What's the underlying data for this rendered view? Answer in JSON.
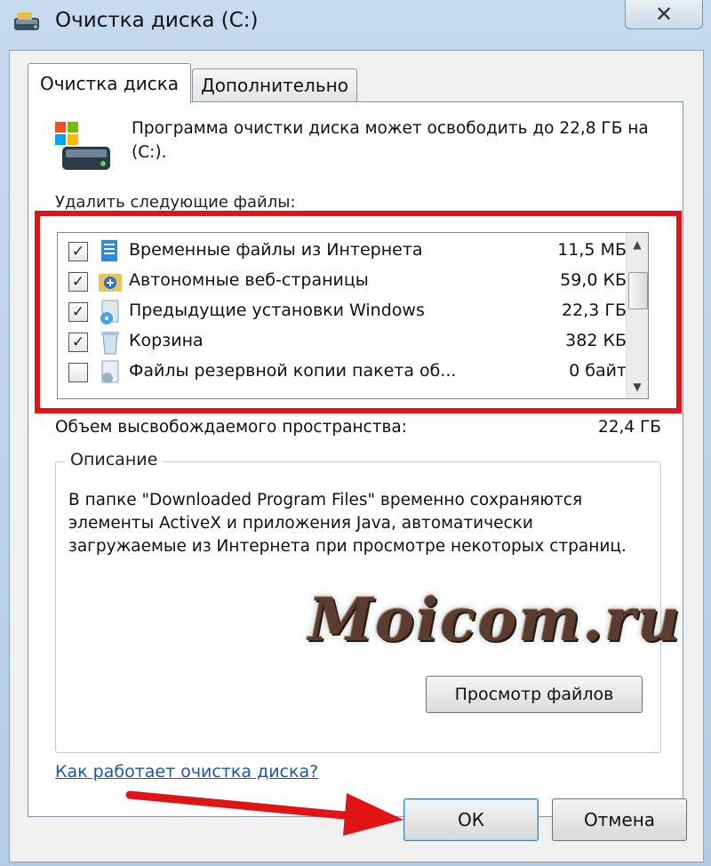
{
  "window": {
    "title": "Очистка диска  (C:)",
    "close_symbol": "✕"
  },
  "tabs": [
    {
      "label": "Очистка диска",
      "active": true
    },
    {
      "label": "Дополнительно",
      "active": false
    }
  ],
  "info": {
    "text": "Программа очистки диска может освободить до 22,8 ГБ на  (C:).",
    "icon": "disk-cleanup-icon"
  },
  "files_section_label": "Удалить следующие файлы:",
  "files": [
    {
      "name": "Временные файлы из Интернета",
      "size": "11,5 МБ",
      "checked": true,
      "icon": "temp-files-icon"
    },
    {
      "name": "Автономные веб-страницы",
      "size": "59,0 КБ",
      "checked": true,
      "icon": "offline-pages-icon"
    },
    {
      "name": "Предыдущие установки Windows",
      "size": "22,3 ГБ",
      "checked": true,
      "icon": "previous-installs-icon"
    },
    {
      "name": "Корзина",
      "size": "382 КБ",
      "checked": true,
      "icon": "recycle-bin-icon"
    },
    {
      "name": "Файлы резервной копии пакета об...",
      "size": "0 байт",
      "checked": false,
      "icon": "service-pack-backup-icon"
    }
  ],
  "space": {
    "label": "Объем высвобождаемого пространства:",
    "value": "22,4 ГБ"
  },
  "description": {
    "title": "Описание",
    "text": "В папке \"Downloaded Program Files\" временно сохраняются элементы ActiveX и приложения Java, автоматически загружаемые из Интернета при просмотре некоторых страниц."
  },
  "watermark": "Moicom.ru",
  "buttons": {
    "view_files": "Просмотр файлов",
    "ok": "ОК",
    "cancel": "Отмена"
  },
  "help_link": "Как работает очистка диска?",
  "colors": {
    "highlight": "#e01414",
    "link": "#1d56a8",
    "arrow": "#e01414"
  }
}
